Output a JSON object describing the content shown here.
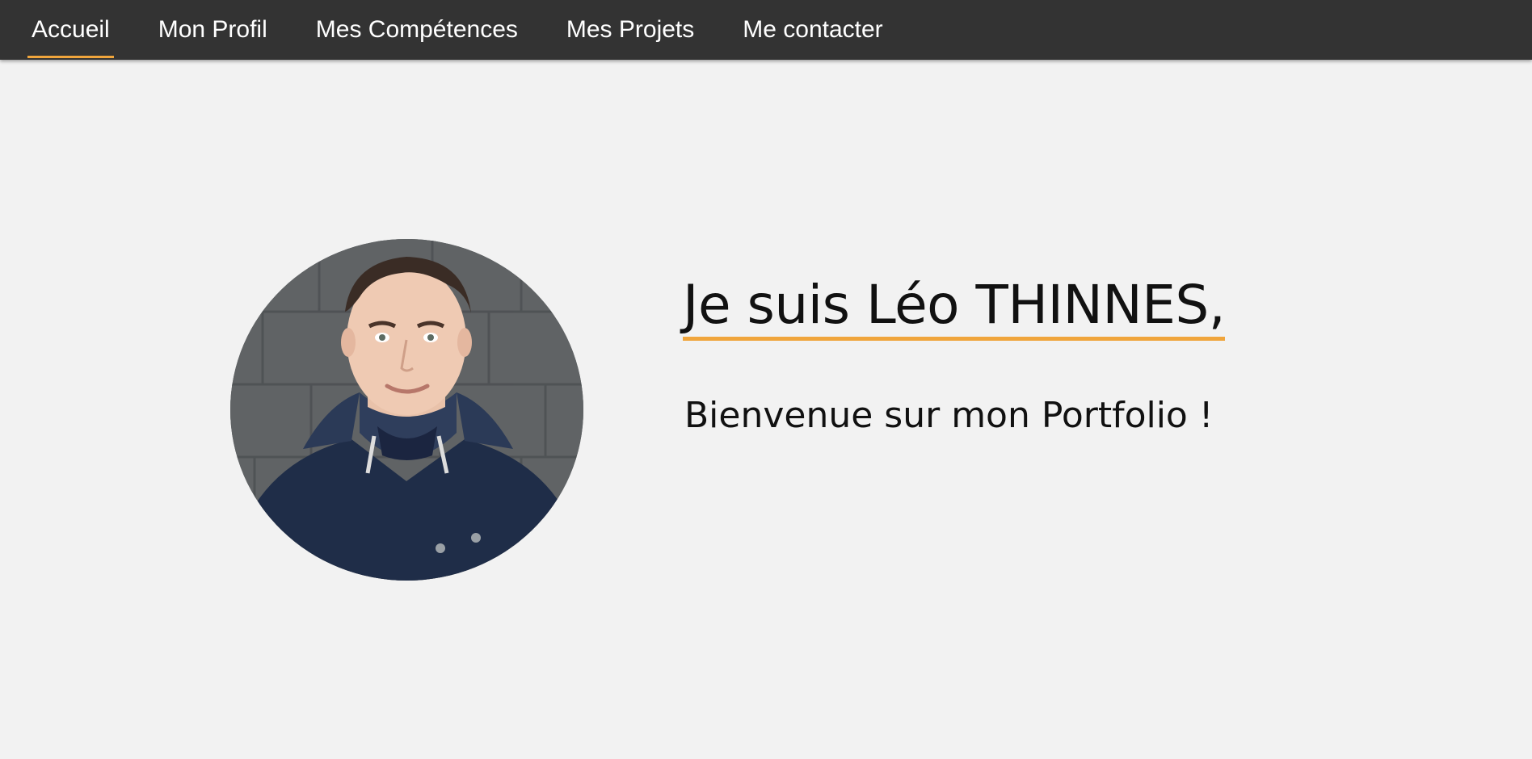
{
  "nav": {
    "items": [
      {
        "label": "Accueil",
        "active": true
      },
      {
        "label": "Mon Profil",
        "active": false
      },
      {
        "label": "Mes Compétences",
        "active": false
      },
      {
        "label": "Mes Projets",
        "active": false
      },
      {
        "label": "Me contacter",
        "active": false
      }
    ]
  },
  "hero": {
    "headline": "Je suis Léo THINNES,",
    "subheadline": "Bienvenue sur mon Portfolio !",
    "avatar_icon": "profile-photo"
  },
  "colors": {
    "navbar_bg": "#333333",
    "page_bg": "#f2f2f2",
    "accent": "#f0a53c",
    "text": "#111111"
  }
}
